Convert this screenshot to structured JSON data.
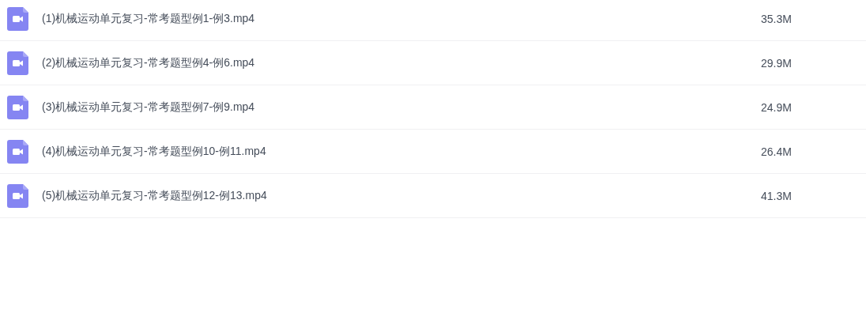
{
  "files": [
    {
      "name": "(1)机械运动单元复习-常考题型例1-例3.mp4",
      "size": "35.3M"
    },
    {
      "name": "(2)机械运动单元复习-常考题型例4-例6.mp4",
      "size": "29.9M"
    },
    {
      "name": "(3)机械运动单元复习-常考题型例7-例9.mp4",
      "size": "24.9M"
    },
    {
      "name": "(4)机械运动单元复习-常考题型例10-例11.mp4",
      "size": "26.4M"
    },
    {
      "name": "(5)机械运动单元复习-常考题型例12-例13.mp4",
      "size": "41.3M"
    }
  ]
}
